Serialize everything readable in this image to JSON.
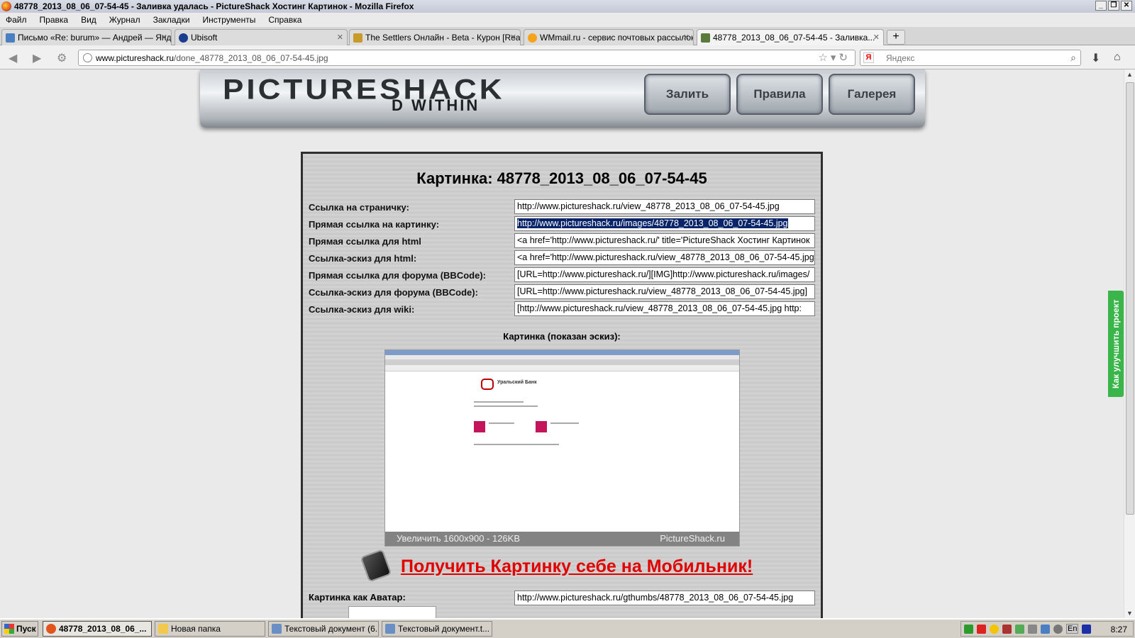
{
  "window": {
    "title": "48778_2013_08_06_07-54-45 - Заливка удалась - PictureShack Хостинг Картинок - Mozilla Firefox",
    "controls": [
      "_",
      "❐",
      "✕"
    ]
  },
  "menu": [
    "Файл",
    "Правка",
    "Вид",
    "Журнал",
    "Закладки",
    "Инструменты",
    "Справка"
  ],
  "tabs": [
    {
      "label": "Письмо «Re: burum» — Андрей — Янде...",
      "icon": "mail-icon",
      "color": "#4a7fc1"
    },
    {
      "label": "Ubisoft",
      "icon": "ubisoft-icon",
      "color": "#1b3d8f"
    },
    {
      "label": "The Settlers Онлайн - Beta - Курон [Rea...",
      "icon": "settlers-icon",
      "color": "#c89a2a"
    },
    {
      "label": "WMmail.ru - сервис почтовых рассылок...",
      "icon": "wmmail-icon",
      "color": "#f4a31a"
    },
    {
      "label": "48778_2013_08_06_07-54-45 - Заливка...",
      "icon": "pictureshack-icon",
      "color": "#5a7a3a"
    }
  ],
  "nav": {
    "url_host": "www.pictureshack.ru",
    "url_path": "/done_48778_2013_08_06_07-54-45.jpg",
    "search_placeholder": "Яндекс"
  },
  "site": {
    "logo": "PICTURESHACK",
    "logo_sub": "D WITHIN",
    "buttons": [
      "Залить",
      "Правила",
      "Галерея"
    ]
  },
  "panel": {
    "title": "Картинка: 48778_2013_08_06_07-54-45",
    "fields": [
      {
        "label": "Ссылка на страничку:",
        "value": "http://www.pictureshack.ru/view_48778_2013_08_06_07-54-45.jpg"
      },
      {
        "label": "Прямая ссылка на картинку:",
        "value": "http://www.pictureshack.ru/images/48778_2013_08_06_07-54-45.jpg"
      },
      {
        "label": "Прямая ссылка для html",
        "value": "<a href='http://www.pictureshack.ru/' title='PictureShack Хостинг Картинок"
      },
      {
        "label": "Ссылка-эскиз для html:",
        "value": "<a href='http://www.pictureshack.ru/view_48778_2013_08_06_07-54-45.jpg'"
      },
      {
        "label": "Прямая ссылка для форума (BBCode):",
        "value": "[URL=http://www.pictureshack.ru/][IMG]http://www.pictureshack.ru/images/"
      },
      {
        "label": "Ссылка-эскиз для форума (BBCode):",
        "value": "[URL=http://www.pictureshack.ru/view_48778_2013_08_06_07-54-45.jpg]"
      },
      {
        "label": "Ссылка-эскиз для wiki:",
        "value": "[http://www.pictureshack.ru/view_48778_2013_08_06_07-54-45.jpg http:"
      }
    ],
    "thumb_caption": "Картинка (показан эскиз):",
    "thumb_bank_name": "Уральский Банк",
    "thumb_overlay_left": "Увеличить  1600x900 - 126KB",
    "thumb_overlay_right": "PictureShack.ru",
    "mobile_link": "Получить Картинку себе на Мобильник!",
    "avatar_label": "Картинка как Аватар:",
    "avatar_value": "http://www.pictureshack.ru/gthumbs/48778_2013_08_06_07-54-45.jpg"
  },
  "feedback_tab": "Как улучшить проект",
  "taskbar": {
    "start": "Пуск",
    "tasks": [
      {
        "label": "48778_2013_08_06_...",
        "icon": "firefox-icon",
        "color": "#e0561c",
        "active": true
      },
      {
        "label": "Новая папка",
        "icon": "folder-icon",
        "color": "#f2c94c",
        "active": false
      },
      {
        "label": "Текстовый документ (6...",
        "icon": "notepad-icon",
        "color": "#6a8fc4",
        "active": false
      },
      {
        "label": "Текстовый документ.t...",
        "icon": "notepad-icon",
        "color": "#6a8fc4",
        "active": false
      }
    ],
    "lang": "En",
    "clock": "8:27"
  }
}
